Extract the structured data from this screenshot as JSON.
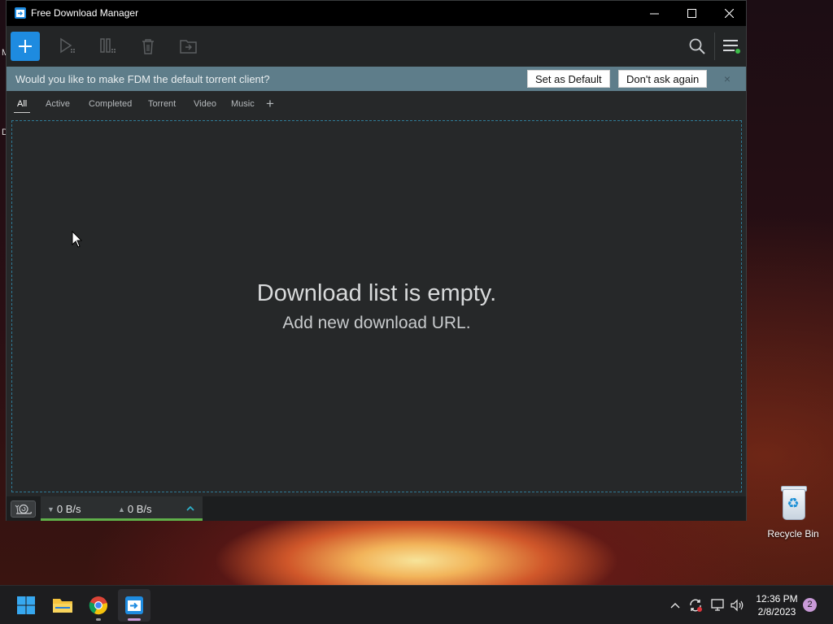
{
  "window": {
    "title": "Free Download Manager"
  },
  "notice": {
    "message": "Would you like to make FDM the default torrent client?",
    "set_default_label": "Set as Default",
    "dont_ask_label": "Don't ask again",
    "close_glyph": "×"
  },
  "tabs": [
    {
      "label": "All",
      "active": true
    },
    {
      "label": "Active",
      "active": false
    },
    {
      "label": "Completed",
      "active": false
    },
    {
      "label": "Torrent",
      "active": false
    },
    {
      "label": "Video",
      "active": false
    },
    {
      "label": "Music",
      "active": false
    }
  ],
  "tabs_add_glyph": "+",
  "empty_state": {
    "title": "Download list is empty.",
    "subtitle": "Add new download URL."
  },
  "status": {
    "download_speed": "0 B/s",
    "upload_speed": "0 B/s"
  },
  "desktop": {
    "left_edge_text_1": "M",
    "left_edge_text_2": "D",
    "recycle_bin_label": "Recycle Bin"
  },
  "taskbar": {
    "apps": [
      {
        "name": "Start",
        "icon": "windows-logo-icon"
      },
      {
        "name": "File Explorer",
        "icon": "folder-icon"
      },
      {
        "name": "Google Chrome",
        "icon": "chrome-icon"
      },
      {
        "name": "Free Download Manager",
        "icon": "fdm-icon"
      }
    ],
    "time": "12:36 PM",
    "date": "2/8/2023",
    "notification_count": "2"
  },
  "colors": {
    "accent": "#1e8be0",
    "notice_bg": "#5e7d8a",
    "window_bg": "#262829",
    "speed_bar": "#5fb04a"
  }
}
